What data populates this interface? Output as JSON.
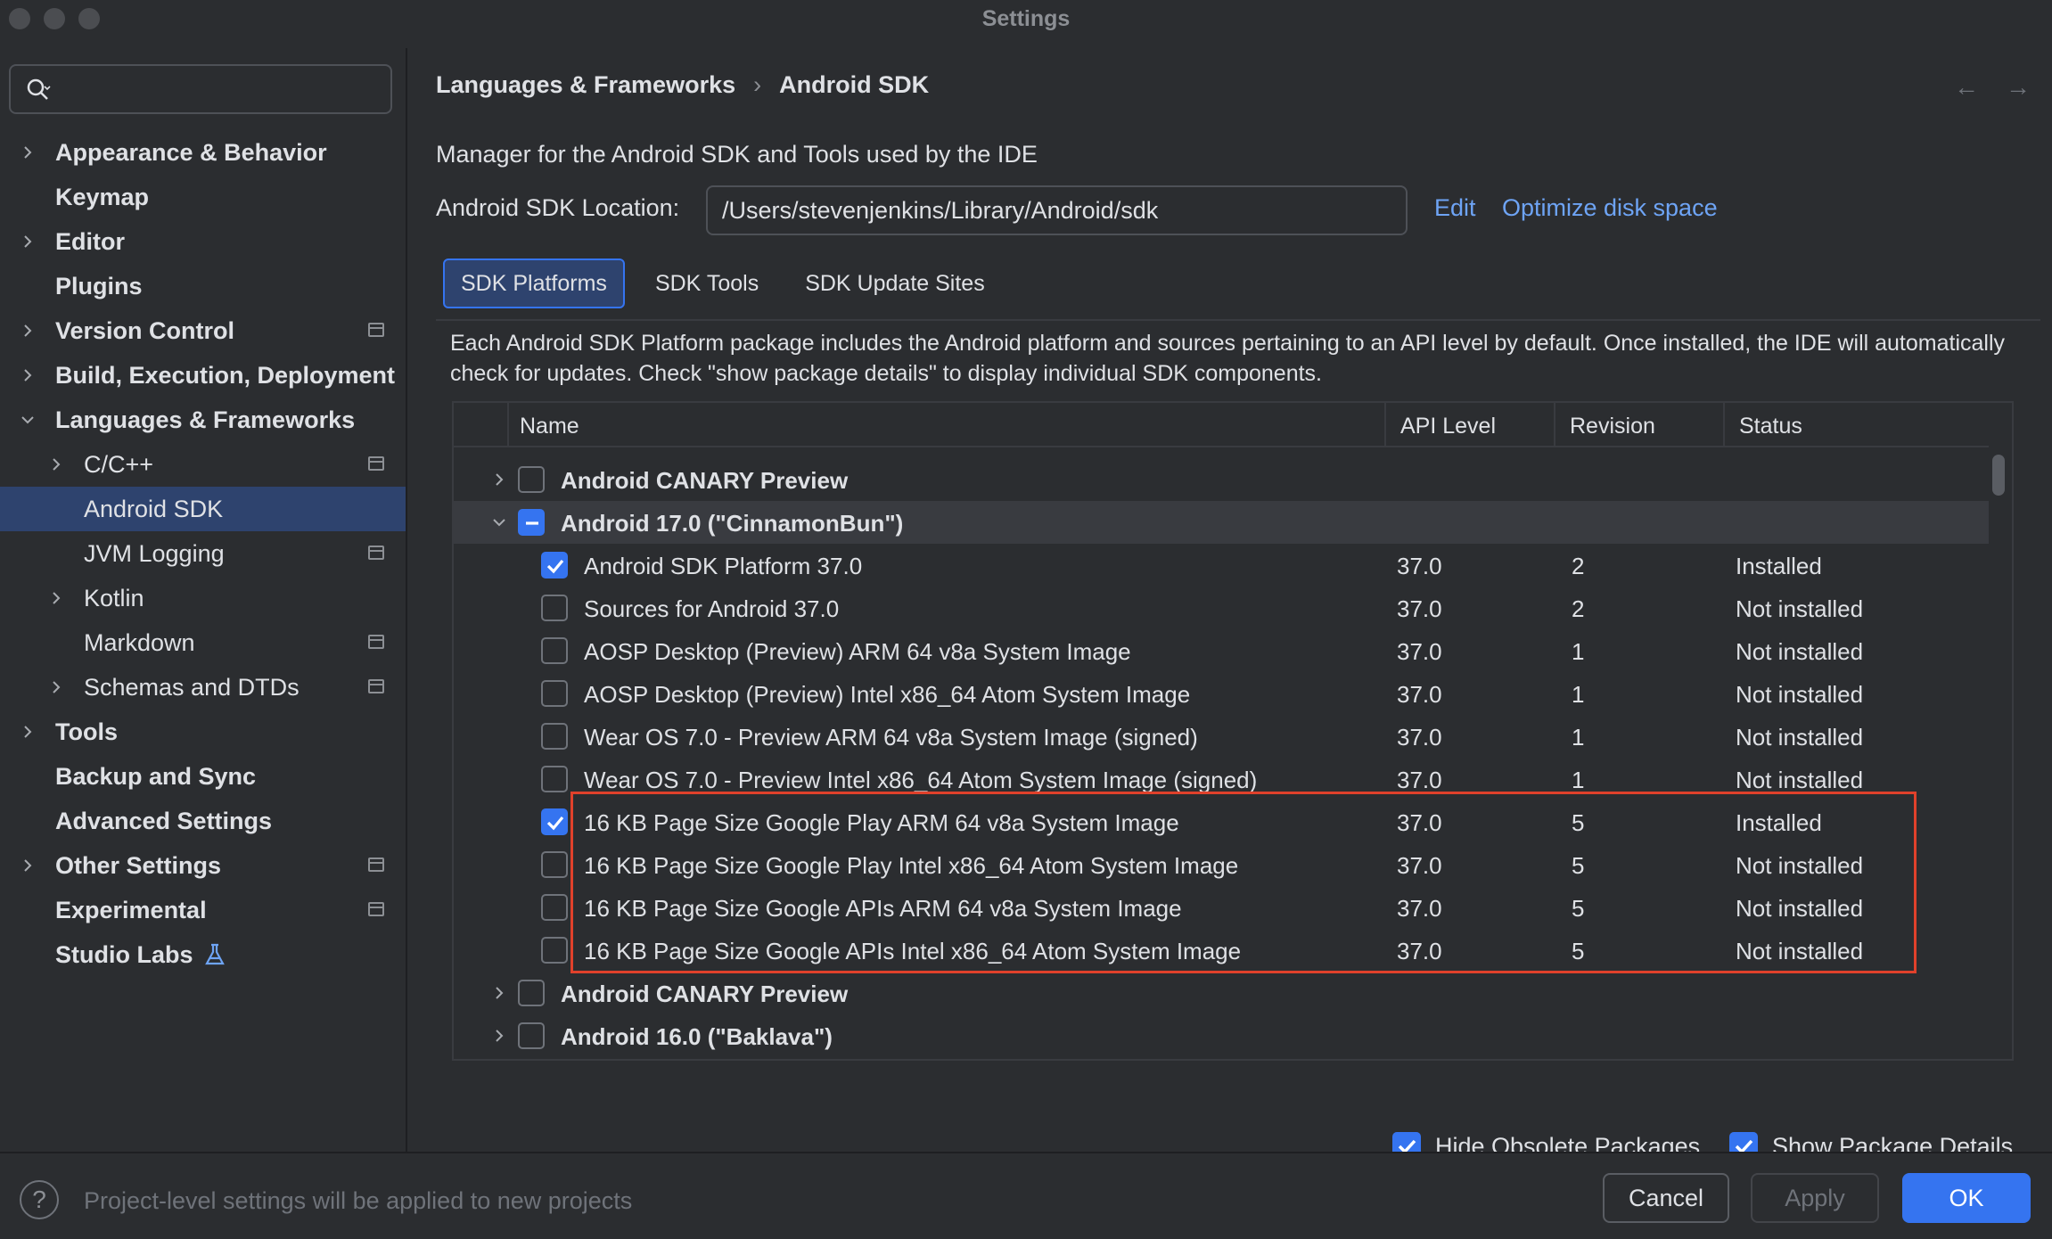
{
  "window": {
    "title": "Settings"
  },
  "search": {
    "placeholder": ""
  },
  "sidebar": {
    "items": [
      {
        "label": "Appearance & Behavior",
        "chevron": "right",
        "badge": false
      },
      {
        "label": "Keymap",
        "chevron": "none",
        "badge": false
      },
      {
        "label": "Editor",
        "chevron": "right",
        "badge": false
      },
      {
        "label": "Plugins",
        "chevron": "none",
        "badge": false
      },
      {
        "label": "Version Control",
        "chevron": "right",
        "badge": true
      },
      {
        "label": "Build, Execution, Deployment",
        "chevron": "right",
        "badge": false
      },
      {
        "label": "Languages & Frameworks",
        "chevron": "down",
        "badge": false
      },
      {
        "label": "C/C++",
        "chevron": "right",
        "badge": true
      },
      {
        "label": "Android SDK",
        "chevron": "none",
        "badge": false,
        "selected": true
      },
      {
        "label": "JVM Logging",
        "chevron": "none",
        "badge": true
      },
      {
        "label": "Kotlin",
        "chevron": "right",
        "badge": false
      },
      {
        "label": "Markdown",
        "chevron": "none",
        "badge": true
      },
      {
        "label": "Schemas and DTDs",
        "chevron": "right",
        "badge": true
      },
      {
        "label": "Tools",
        "chevron": "right",
        "badge": false
      },
      {
        "label": "Backup and Sync",
        "chevron": "none",
        "badge": false
      },
      {
        "label": "Advanced Settings",
        "chevron": "none",
        "badge": false
      },
      {
        "label": "Other Settings",
        "chevron": "right",
        "badge": true
      },
      {
        "label": "Experimental",
        "chevron": "none",
        "badge": true
      },
      {
        "label": "Studio Labs",
        "chevron": "none",
        "badge": false,
        "icon": "flask-icon"
      }
    ]
  },
  "breadcrumb": {
    "parent": "Languages & Frameworks",
    "separator": "›",
    "current": "Android SDK"
  },
  "nav_arrows": {
    "back": "←",
    "forward": "→"
  },
  "main": {
    "description": "Manager for the Android SDK and Tools used by the IDE",
    "location_label": "Android SDK Location:",
    "location_value": "/Users/stevenjenkins/Library/Android/sdk",
    "edit_link": "Edit",
    "optimize_link": "Optimize disk space",
    "tabs": [
      {
        "label": "SDK Platforms",
        "active": true
      },
      {
        "label": "SDK Tools",
        "active": false
      },
      {
        "label": "SDK Update Sites",
        "active": false
      }
    ],
    "info_text": "Each Android SDK Platform package includes the Android platform and sources pertaining to an API level by default. Once installed, the IDE will automatically check for updates. Check \"show package details\" to display individual SDK components."
  },
  "table": {
    "headers": {
      "name": "Name",
      "api": "API Level",
      "revision": "Revision",
      "status": "Status"
    },
    "rows": [
      {
        "type": "group",
        "name": "Android CANARY Preview",
        "expanded": false,
        "state": "unchecked",
        "api": "",
        "revision": "",
        "status": ""
      },
      {
        "type": "group",
        "name": "Android 17.0 (\"CinnamonBun\")",
        "expanded": true,
        "state": "partial",
        "api": "",
        "revision": "",
        "status": ""
      },
      {
        "type": "item",
        "name": "Android SDK Platform 37.0",
        "state": "checked",
        "api": "37.0",
        "revision": "2",
        "status": "Installed"
      },
      {
        "type": "item",
        "name": "Sources for Android 37.0",
        "state": "unchecked",
        "api": "37.0",
        "revision": "2",
        "status": "Not installed"
      },
      {
        "type": "item",
        "name": "AOSP Desktop (Preview) ARM 64 v8a System Image",
        "state": "unchecked",
        "api": "37.0",
        "revision": "1",
        "status": "Not installed"
      },
      {
        "type": "item",
        "name": "AOSP Desktop (Preview) Intel x86_64 Atom System Image",
        "state": "unchecked",
        "api": "37.0",
        "revision": "1",
        "status": "Not installed"
      },
      {
        "type": "item",
        "name": "Wear OS 7.0 - Preview ARM 64 v8a System Image (signed)",
        "state": "unchecked",
        "api": "37.0",
        "revision": "1",
        "status": "Not installed"
      },
      {
        "type": "item",
        "name": "Wear OS 7.0 - Preview Intel x86_64 Atom System Image (signed)",
        "state": "unchecked",
        "api": "37.0",
        "revision": "1",
        "status": "Not installed"
      },
      {
        "type": "item",
        "name": "16 KB Page Size Google Play ARM 64 v8a System Image",
        "state": "checked",
        "api": "37.0",
        "revision": "5",
        "status": "Installed"
      },
      {
        "type": "item",
        "name": "16 KB Page Size Google Play Intel x86_64 Atom System Image",
        "state": "unchecked",
        "api": "37.0",
        "revision": "5",
        "status": "Not installed"
      },
      {
        "type": "item",
        "name": "16 KB Page Size Google APIs ARM 64 v8a System Image",
        "state": "unchecked",
        "api": "37.0",
        "revision": "5",
        "status": "Not installed"
      },
      {
        "type": "item",
        "name": "16 KB Page Size Google APIs Intel x86_64 Atom System Image",
        "state": "unchecked",
        "api": "37.0",
        "revision": "5",
        "status": "Not installed"
      },
      {
        "type": "group",
        "name": "Android CANARY Preview",
        "expanded": false,
        "state": "unchecked",
        "api": "",
        "revision": "",
        "status": ""
      },
      {
        "type": "group",
        "name": "Android 16.0 (\"Baklava\")",
        "expanded": false,
        "state": "unchecked",
        "api": "",
        "revision": "",
        "status": ""
      }
    ]
  },
  "options": {
    "hide_obsolete": {
      "label": "Hide Obsolete Packages",
      "checked": true
    },
    "show_details": {
      "label": "Show Package Details",
      "checked": true
    }
  },
  "footer": {
    "help": "?",
    "message": "Project-level settings will be applied to new projects",
    "cancel": "Cancel",
    "apply": "Apply",
    "ok": "OK"
  },
  "colors": {
    "accent": "#3574f0",
    "highlight_border": "#e0412b",
    "link": "#6ea4f5",
    "selection": "#2e436e"
  }
}
